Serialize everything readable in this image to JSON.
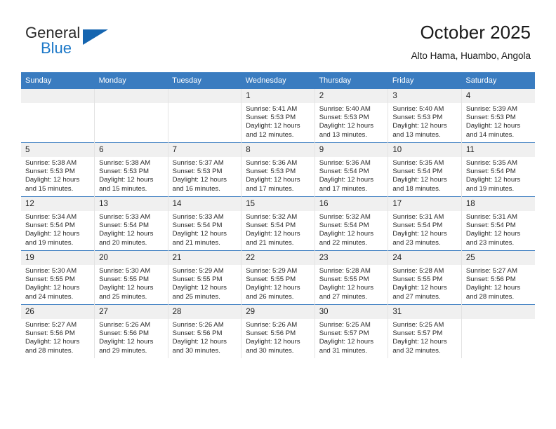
{
  "brand": {
    "name_part1": "General",
    "name_part2": "Blue"
  },
  "header": {
    "title": "October 2025",
    "location": "Alto Hama, Huambo, Angola"
  },
  "calendar": {
    "weekday_headers": [
      "Sunday",
      "Monday",
      "Tuesday",
      "Wednesday",
      "Thursday",
      "Friday",
      "Saturday"
    ],
    "labels": {
      "sunrise": "Sunrise:",
      "sunset": "Sunset:",
      "daylight": "Daylight:"
    },
    "colors": {
      "header_blue": "#3a7cc0",
      "daynum_band": "#f0f0f0",
      "brand_blue": "#1c78c8",
      "logo_triangle": "#1565b0"
    },
    "weeks": [
      [
        {
          "day": "",
          "empty": true
        },
        {
          "day": "",
          "empty": true
        },
        {
          "day": "",
          "empty": true
        },
        {
          "day": "1",
          "sunrise": "Sunrise: 5:41 AM",
          "sunset": "Sunset: 5:53 PM",
          "daylight_line1": "Daylight: 12 hours",
          "daylight_line2": "and 12 minutes."
        },
        {
          "day": "2",
          "sunrise": "Sunrise: 5:40 AM",
          "sunset": "Sunset: 5:53 PM",
          "daylight_line1": "Daylight: 12 hours",
          "daylight_line2": "and 13 minutes."
        },
        {
          "day": "3",
          "sunrise": "Sunrise: 5:40 AM",
          "sunset": "Sunset: 5:53 PM",
          "daylight_line1": "Daylight: 12 hours",
          "daylight_line2": "and 13 minutes."
        },
        {
          "day": "4",
          "sunrise": "Sunrise: 5:39 AM",
          "sunset": "Sunset: 5:53 PM",
          "daylight_line1": "Daylight: 12 hours",
          "daylight_line2": "and 14 minutes."
        }
      ],
      [
        {
          "day": "5",
          "sunrise": "Sunrise: 5:38 AM",
          "sunset": "Sunset: 5:53 PM",
          "daylight_line1": "Daylight: 12 hours",
          "daylight_line2": "and 15 minutes."
        },
        {
          "day": "6",
          "sunrise": "Sunrise: 5:38 AM",
          "sunset": "Sunset: 5:53 PM",
          "daylight_line1": "Daylight: 12 hours",
          "daylight_line2": "and 15 minutes."
        },
        {
          "day": "7",
          "sunrise": "Sunrise: 5:37 AM",
          "sunset": "Sunset: 5:53 PM",
          "daylight_line1": "Daylight: 12 hours",
          "daylight_line2": "and 16 minutes."
        },
        {
          "day": "8",
          "sunrise": "Sunrise: 5:36 AM",
          "sunset": "Sunset: 5:53 PM",
          "daylight_line1": "Daylight: 12 hours",
          "daylight_line2": "and 17 minutes."
        },
        {
          "day": "9",
          "sunrise": "Sunrise: 5:36 AM",
          "sunset": "Sunset: 5:54 PM",
          "daylight_line1": "Daylight: 12 hours",
          "daylight_line2": "and 17 minutes."
        },
        {
          "day": "10",
          "sunrise": "Sunrise: 5:35 AM",
          "sunset": "Sunset: 5:54 PM",
          "daylight_line1": "Daylight: 12 hours",
          "daylight_line2": "and 18 minutes."
        },
        {
          "day": "11",
          "sunrise": "Sunrise: 5:35 AM",
          "sunset": "Sunset: 5:54 PM",
          "daylight_line1": "Daylight: 12 hours",
          "daylight_line2": "and 19 minutes."
        }
      ],
      [
        {
          "day": "12",
          "sunrise": "Sunrise: 5:34 AM",
          "sunset": "Sunset: 5:54 PM",
          "daylight_line1": "Daylight: 12 hours",
          "daylight_line2": "and 19 minutes."
        },
        {
          "day": "13",
          "sunrise": "Sunrise: 5:33 AM",
          "sunset": "Sunset: 5:54 PM",
          "daylight_line1": "Daylight: 12 hours",
          "daylight_line2": "and 20 minutes."
        },
        {
          "day": "14",
          "sunrise": "Sunrise: 5:33 AM",
          "sunset": "Sunset: 5:54 PM",
          "daylight_line1": "Daylight: 12 hours",
          "daylight_line2": "and 21 minutes."
        },
        {
          "day": "15",
          "sunrise": "Sunrise: 5:32 AM",
          "sunset": "Sunset: 5:54 PM",
          "daylight_line1": "Daylight: 12 hours",
          "daylight_line2": "and 21 minutes."
        },
        {
          "day": "16",
          "sunrise": "Sunrise: 5:32 AM",
          "sunset": "Sunset: 5:54 PM",
          "daylight_line1": "Daylight: 12 hours",
          "daylight_line2": "and 22 minutes."
        },
        {
          "day": "17",
          "sunrise": "Sunrise: 5:31 AM",
          "sunset": "Sunset: 5:54 PM",
          "daylight_line1": "Daylight: 12 hours",
          "daylight_line2": "and 23 minutes."
        },
        {
          "day": "18",
          "sunrise": "Sunrise: 5:31 AM",
          "sunset": "Sunset: 5:54 PM",
          "daylight_line1": "Daylight: 12 hours",
          "daylight_line2": "and 23 minutes."
        }
      ],
      [
        {
          "day": "19",
          "sunrise": "Sunrise: 5:30 AM",
          "sunset": "Sunset: 5:55 PM",
          "daylight_line1": "Daylight: 12 hours",
          "daylight_line2": "and 24 minutes."
        },
        {
          "day": "20",
          "sunrise": "Sunrise: 5:30 AM",
          "sunset": "Sunset: 5:55 PM",
          "daylight_line1": "Daylight: 12 hours",
          "daylight_line2": "and 25 minutes."
        },
        {
          "day": "21",
          "sunrise": "Sunrise: 5:29 AM",
          "sunset": "Sunset: 5:55 PM",
          "daylight_line1": "Daylight: 12 hours",
          "daylight_line2": "and 25 minutes."
        },
        {
          "day": "22",
          "sunrise": "Sunrise: 5:29 AM",
          "sunset": "Sunset: 5:55 PM",
          "daylight_line1": "Daylight: 12 hours",
          "daylight_line2": "and 26 minutes."
        },
        {
          "day": "23",
          "sunrise": "Sunrise: 5:28 AM",
          "sunset": "Sunset: 5:55 PM",
          "daylight_line1": "Daylight: 12 hours",
          "daylight_line2": "and 27 minutes."
        },
        {
          "day": "24",
          "sunrise": "Sunrise: 5:28 AM",
          "sunset": "Sunset: 5:55 PM",
          "daylight_line1": "Daylight: 12 hours",
          "daylight_line2": "and 27 minutes."
        },
        {
          "day": "25",
          "sunrise": "Sunrise: 5:27 AM",
          "sunset": "Sunset: 5:56 PM",
          "daylight_line1": "Daylight: 12 hours",
          "daylight_line2": "and 28 minutes."
        }
      ],
      [
        {
          "day": "26",
          "sunrise": "Sunrise: 5:27 AM",
          "sunset": "Sunset: 5:56 PM",
          "daylight_line1": "Daylight: 12 hours",
          "daylight_line2": "and 28 minutes."
        },
        {
          "day": "27",
          "sunrise": "Sunrise: 5:26 AM",
          "sunset": "Sunset: 5:56 PM",
          "daylight_line1": "Daylight: 12 hours",
          "daylight_line2": "and 29 minutes."
        },
        {
          "day": "28",
          "sunrise": "Sunrise: 5:26 AM",
          "sunset": "Sunset: 5:56 PM",
          "daylight_line1": "Daylight: 12 hours",
          "daylight_line2": "and 30 minutes."
        },
        {
          "day": "29",
          "sunrise": "Sunrise: 5:26 AM",
          "sunset": "Sunset: 5:56 PM",
          "daylight_line1": "Daylight: 12 hours",
          "daylight_line2": "and 30 minutes."
        },
        {
          "day": "30",
          "sunrise": "Sunrise: 5:25 AM",
          "sunset": "Sunset: 5:57 PM",
          "daylight_line1": "Daylight: 12 hours",
          "daylight_line2": "and 31 minutes."
        },
        {
          "day": "31",
          "sunrise": "Sunrise: 5:25 AM",
          "sunset": "Sunset: 5:57 PM",
          "daylight_line1": "Daylight: 12 hours",
          "daylight_line2": "and 32 minutes."
        },
        {
          "day": "",
          "empty": true
        }
      ]
    ]
  }
}
